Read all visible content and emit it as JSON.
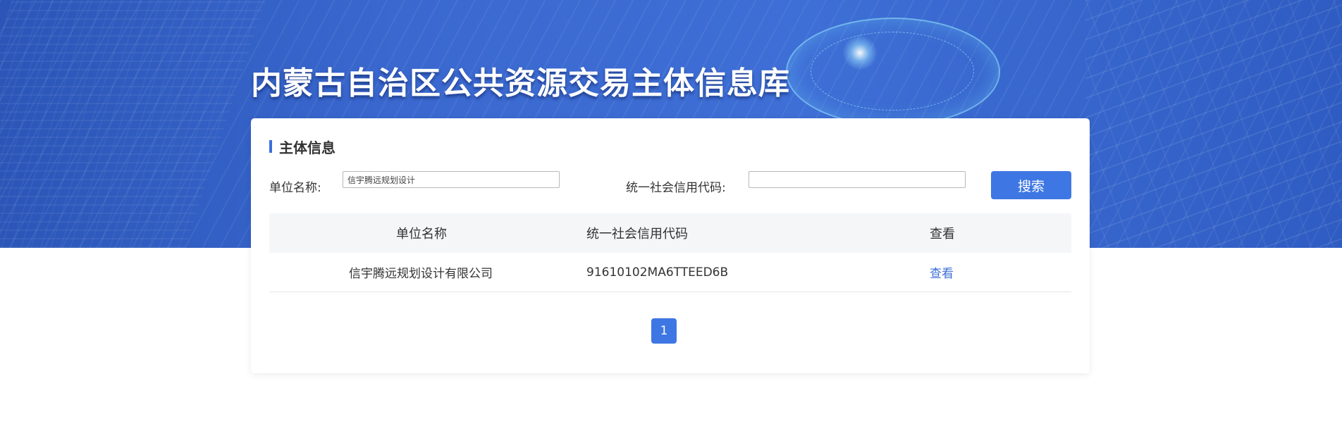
{
  "header": {
    "site_title": "内蒙古自治区公共资源交易主体信息库"
  },
  "section": {
    "title": "主体信息"
  },
  "search": {
    "unit_name_label": "单位名称:",
    "unit_name_value": "信宇腾远规划设计",
    "credit_code_label": "统一社会信用代码:",
    "credit_code_value": "",
    "button_label": "搜索"
  },
  "table": {
    "columns": [
      "单位名称",
      "统一社会信用代码",
      "查看"
    ],
    "rows": [
      {
        "unit_name": "信宇腾远规划设计有限公司",
        "credit_code": "91610102MA6TTEED6B",
        "view": "查看"
      }
    ]
  },
  "pagination": {
    "current_page": "1"
  },
  "colors": {
    "accent": "#3e77e3",
    "banner": "#3a68cf",
    "link": "#3e6fd6"
  }
}
